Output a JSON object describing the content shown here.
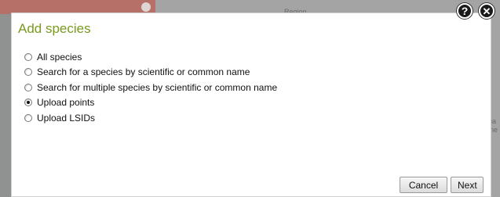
{
  "background": {
    "map_label_1": "Region",
    "map_label_2": "ua",
    "map_label_3": "ine"
  },
  "dialog": {
    "title": "Add species",
    "options": [
      {
        "label": "All species",
        "checked": false
      },
      {
        "label": "Search for a species by scientific or common name",
        "checked": false
      },
      {
        "label": "Search for multiple species by scientific or common name",
        "checked": false
      },
      {
        "label": "Upload points",
        "checked": true
      },
      {
        "label": "Upload LSIDs",
        "checked": false
      }
    ],
    "cancel_label": "Cancel",
    "next_label": "Next"
  },
  "icons": {
    "help": "?",
    "close": "✕"
  },
  "colors": {
    "title": "#7a9a1e",
    "header_bar": "#b77067"
  }
}
